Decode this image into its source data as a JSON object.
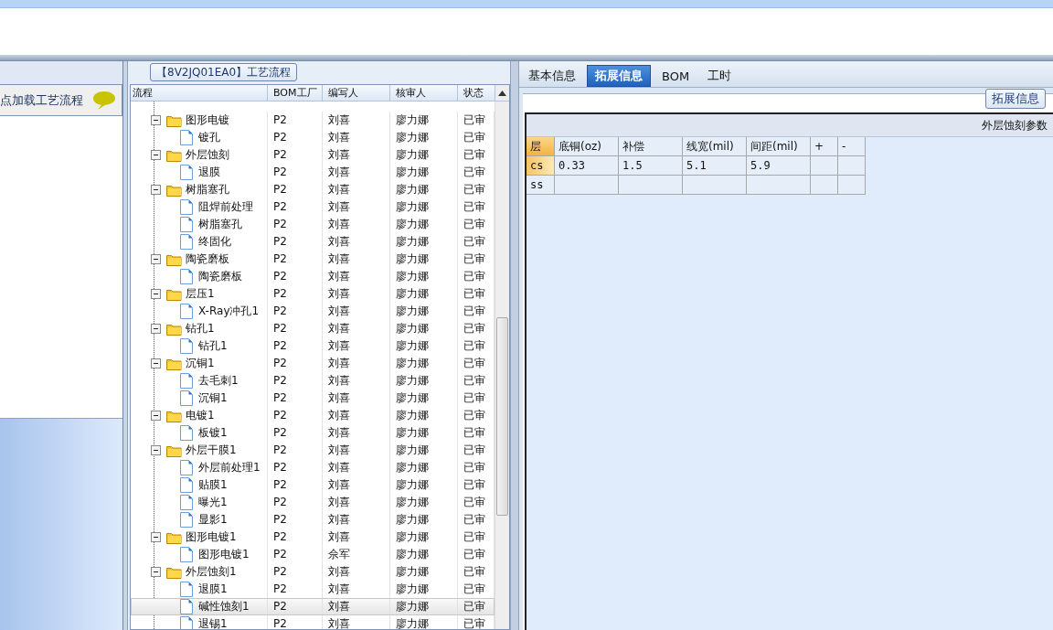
{
  "left_panel": {
    "hint": "点加载工艺流程"
  },
  "process_panel": {
    "title": "【8V2JQ01EA0】工艺流程",
    "columns": [
      "流程",
      "BOM工厂",
      "编写人",
      "核审人",
      "状态"
    ],
    "tree": [
      {
        "name": "图形电镀",
        "bom": "P2",
        "writer": "刘喜",
        "reviewer": "廖力娜",
        "status": "已审",
        "expanded": true,
        "selected": false,
        "children": [
          {
            "name": "镀孔",
            "bom": "P2",
            "writer": "刘喜",
            "reviewer": "廖力娜",
            "status": "已审",
            "selected": false
          }
        ]
      },
      {
        "name": "外层蚀刻",
        "bom": "P2",
        "writer": "刘喜",
        "reviewer": "廖力娜",
        "status": "已审",
        "expanded": true,
        "selected": false,
        "children": [
          {
            "name": "退膜",
            "bom": "P2",
            "writer": "刘喜",
            "reviewer": "廖力娜",
            "status": "已审",
            "selected": false
          }
        ]
      },
      {
        "name": "树脂塞孔",
        "bom": "P2",
        "writer": "刘喜",
        "reviewer": "廖力娜",
        "status": "已审",
        "expanded": true,
        "selected": false,
        "children": [
          {
            "name": "阻焊前处理",
            "bom": "P2",
            "writer": "刘喜",
            "reviewer": "廖力娜",
            "status": "已审",
            "selected": false
          },
          {
            "name": "树脂塞孔",
            "bom": "P2",
            "writer": "刘喜",
            "reviewer": "廖力娜",
            "status": "已审",
            "selected": false
          },
          {
            "name": "终固化",
            "bom": "P2",
            "writer": "刘喜",
            "reviewer": "廖力娜",
            "status": "已审",
            "selected": false
          }
        ]
      },
      {
        "name": "陶瓷磨板",
        "bom": "P2",
        "writer": "刘喜",
        "reviewer": "廖力娜",
        "status": "已审",
        "expanded": true,
        "selected": false,
        "children": [
          {
            "name": "陶瓷磨板",
            "bom": "P2",
            "writer": "刘喜",
            "reviewer": "廖力娜",
            "status": "已审",
            "selected": false
          }
        ]
      },
      {
        "name": "层压1",
        "bom": "P2",
        "writer": "刘喜",
        "reviewer": "廖力娜",
        "status": "已审",
        "expanded": true,
        "selected": false,
        "children": [
          {
            "name": "X-Ray冲孔1",
            "bom": "P2",
            "writer": "刘喜",
            "reviewer": "廖力娜",
            "status": "已审",
            "selected": false
          }
        ]
      },
      {
        "name": "钻孔1",
        "bom": "P2",
        "writer": "刘喜",
        "reviewer": "廖力娜",
        "status": "已审",
        "expanded": true,
        "selected": false,
        "children": [
          {
            "name": "钻孔1",
            "bom": "P2",
            "writer": "刘喜",
            "reviewer": "廖力娜",
            "status": "已审",
            "selected": false
          }
        ]
      },
      {
        "name": "沉铜1",
        "bom": "P2",
        "writer": "刘喜",
        "reviewer": "廖力娜",
        "status": "已审",
        "expanded": true,
        "selected": false,
        "children": [
          {
            "name": "去毛刺1",
            "bom": "P2",
            "writer": "刘喜",
            "reviewer": "廖力娜",
            "status": "已审",
            "selected": false
          },
          {
            "name": "沉铜1",
            "bom": "P2",
            "writer": "刘喜",
            "reviewer": "廖力娜",
            "status": "已审",
            "selected": false
          }
        ]
      },
      {
        "name": "电镀1",
        "bom": "P2",
        "writer": "刘喜",
        "reviewer": "廖力娜",
        "status": "已审",
        "expanded": true,
        "selected": false,
        "children": [
          {
            "name": "板镀1",
            "bom": "P2",
            "writer": "刘喜",
            "reviewer": "廖力娜",
            "status": "已审",
            "selected": false
          }
        ]
      },
      {
        "name": "外层干膜1",
        "bom": "P2",
        "writer": "刘喜",
        "reviewer": "廖力娜",
        "status": "已审",
        "expanded": true,
        "selected": false,
        "children": [
          {
            "name": "外层前处理1",
            "bom": "P2",
            "writer": "刘喜",
            "reviewer": "廖力娜",
            "status": "已审",
            "selected": false
          },
          {
            "name": "贴膜1",
            "bom": "P2",
            "writer": "刘喜",
            "reviewer": "廖力娜",
            "status": "已审",
            "selected": false
          },
          {
            "name": "曝光1",
            "bom": "P2",
            "writer": "刘喜",
            "reviewer": "廖力娜",
            "status": "已审",
            "selected": false
          },
          {
            "name": "显影1",
            "bom": "P2",
            "writer": "刘喜",
            "reviewer": "廖力娜",
            "status": "已审",
            "selected": false
          }
        ]
      },
      {
        "name": "图形电镀1",
        "bom": "P2",
        "writer": "刘喜",
        "reviewer": "廖力娜",
        "status": "已审",
        "expanded": true,
        "selected": false,
        "children": [
          {
            "name": "图形电镀1",
            "bom": "P2",
            "writer": "佘军",
            "reviewer": "廖力娜",
            "status": "已审",
            "selected": false
          }
        ]
      },
      {
        "name": "外层蚀刻1",
        "bom": "P2",
        "writer": "刘喜",
        "reviewer": "廖力娜",
        "status": "已审",
        "expanded": true,
        "selected": false,
        "children": [
          {
            "name": "退膜1",
            "bom": "P2",
            "writer": "刘喜",
            "reviewer": "廖力娜",
            "status": "已审",
            "selected": false
          },
          {
            "name": "碱性蚀刻1",
            "bom": "P2",
            "writer": "刘喜",
            "reviewer": "廖力娜",
            "status": "已审",
            "selected": true
          },
          {
            "name": "退锡1",
            "bom": "P2",
            "writer": "刘喜",
            "reviewer": "廖力娜",
            "status": "已审",
            "selected": false
          }
        ]
      }
    ]
  },
  "detail_panel": {
    "tabs": [
      {
        "label": "基本信息",
        "selected": false
      },
      {
        "label": "拓展信息",
        "selected": true
      },
      {
        "label": "BOM",
        "selected": false
      },
      {
        "label": "工时",
        "selected": false
      }
    ],
    "section_button": "拓展信息",
    "grid_title": "外层蚀刻参数",
    "columns": [
      "层",
      "底铜(oz)",
      "补偿",
      "线宽(mil)",
      "间距(mil)",
      "+",
      "-"
    ],
    "rows": [
      [
        "cs",
        "0.33",
        "1.5",
        "5.1",
        "5.9",
        "",
        ""
      ],
      [
        "ss",
        "",
        "",
        "",
        "",
        "",
        ""
      ]
    ]
  }
}
